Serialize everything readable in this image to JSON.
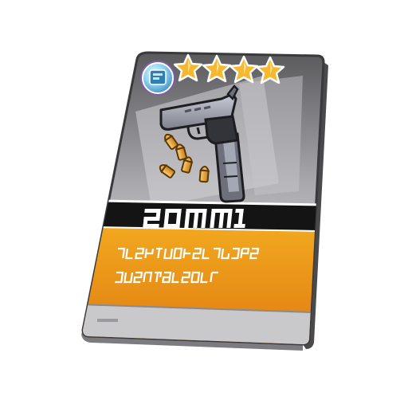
{
  "card": {
    "star_count": 4,
    "stars": [
      "star-1",
      "star-2",
      "star-3",
      "star-4"
    ],
    "badge_icon": "rarity-badge-icon",
    "weapon_icon": "pistol-icon",
    "ammo_icon": "bullet-icon",
    "colors": {
      "frame_dark": "#3a3a3c",
      "body_light": "#e6e6e8",
      "body_mid": "#b7b7ba",
      "band": "#151515",
      "orange_top": "#f0a41c",
      "orange_bottom": "#e07c10",
      "star": "#f7b830",
      "badge": "#3ab7e0"
    }
  }
}
